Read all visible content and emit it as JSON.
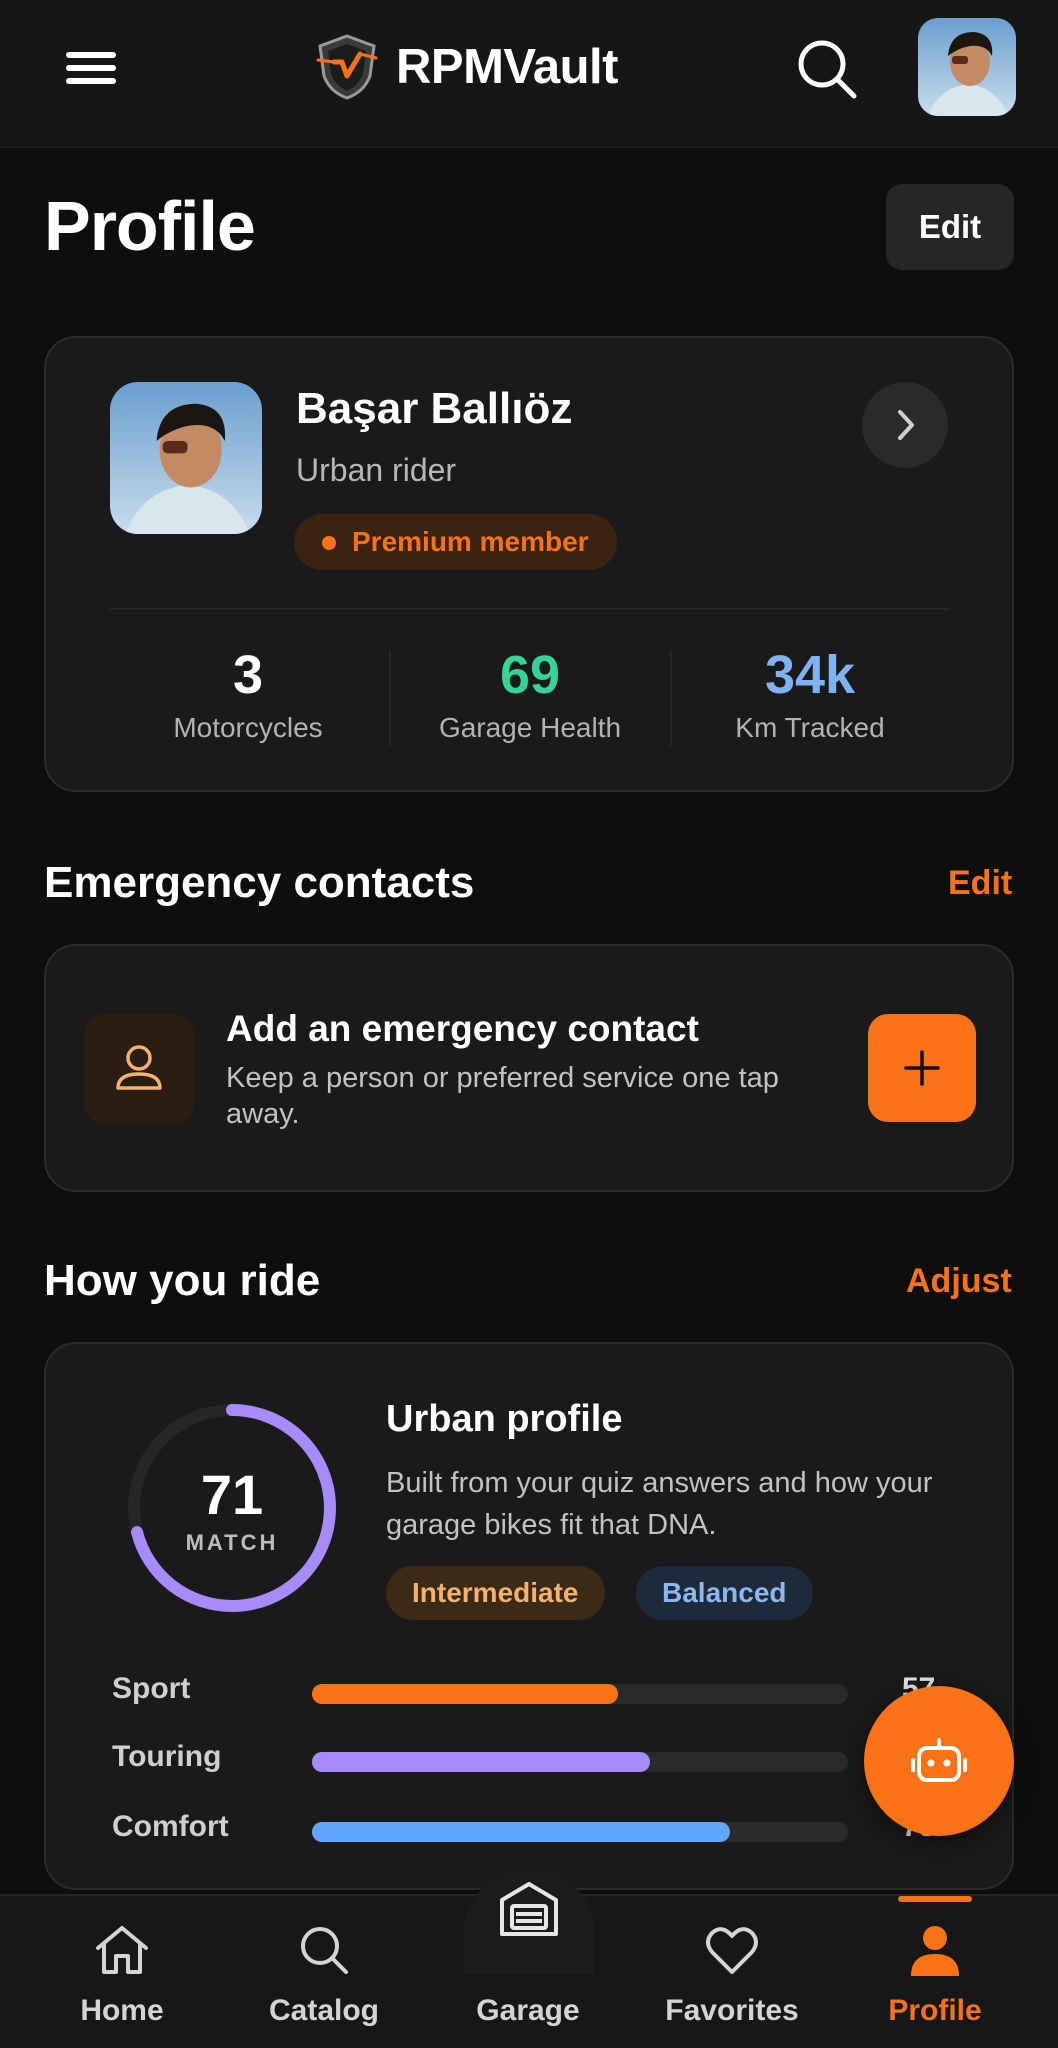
{
  "header": {
    "app_name": "RPMVault",
    "menu_icon": "hamburger-menu-icon",
    "logo_icon": "shield-logo-icon",
    "search_icon": "search-icon"
  },
  "page": {
    "title": "Profile",
    "edit_label": "Edit"
  },
  "profile": {
    "name": "Başar Ballıöz",
    "role": "Urban rider",
    "badge": "Premium member",
    "stats": [
      {
        "value": "3",
        "label": "Motorcycles",
        "color": "#ffffff"
      },
      {
        "value": "69",
        "label": "Garage Health",
        "color": "#34d399"
      },
      {
        "value": "34k",
        "label": "Km Tracked",
        "color": "#7fb2f0"
      }
    ]
  },
  "emergency": {
    "section_title": "Emergency contacts",
    "edit_label": "Edit",
    "card_title": "Add an emergency contact",
    "card_subtitle": "Keep a person or preferred service one tap away."
  },
  "ride": {
    "section_title": "How you ride",
    "adjust_label": "Adjust",
    "match_value": "71",
    "match_fraction": 0.71,
    "match_label": "MATCH",
    "profile_title": "Urban profile",
    "profile_desc": "Built from your quiz answers and how your garage bikes fit that DNA.",
    "tags": [
      "Intermediate",
      "Balanced"
    ],
    "bars": [
      {
        "label": "Sport",
        "value": 57,
        "fraction": 0.57,
        "color": "#f97316"
      },
      {
        "label": "Touring",
        "value": 63,
        "fraction": 0.63,
        "color": "#a78bfa"
      },
      {
        "label": "Comfort",
        "value": 78,
        "fraction": 0.78,
        "color": "#60a5fa"
      }
    ]
  },
  "fab": {
    "icon": "robot-assistant-icon"
  },
  "nav": {
    "items": [
      {
        "label": "Home",
        "icon": "home-icon"
      },
      {
        "label": "Catalog",
        "icon": "search-icon"
      },
      {
        "label": "Garage",
        "icon": "garage-icon"
      },
      {
        "label": "Favorites",
        "icon": "heart-icon"
      },
      {
        "label": "Profile",
        "icon": "person-icon"
      }
    ],
    "active": "Profile"
  },
  "colors": {
    "accent": "#f97316",
    "background": "#0e0e0e",
    "card": "#1a1a1a"
  }
}
